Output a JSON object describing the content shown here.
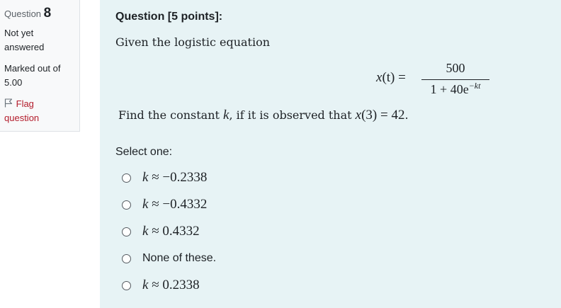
{
  "info": {
    "question_label": "Question",
    "question_number": "8",
    "state_line1": "Not yet",
    "state_line2": "answered",
    "grade_line1": "Marked out of",
    "grade_line2": "5.00",
    "flag_line1": "Flag",
    "flag_line2": "question",
    "flag_icon": "flag-outline-icon"
  },
  "question": {
    "title": "Question [5 points]:",
    "intro": "Given the logistic equation",
    "equation": {
      "lhs_var": "x",
      "lhs_rest": "(t) =",
      "numerator": "500",
      "denominator_base": "1 + 40e",
      "denominator_exponent": "−kt"
    },
    "find_text_before": "Find the constant ",
    "find_var": "k",
    "find_text_mid": ", if it is observed that ",
    "find_condition_var": "x",
    "find_condition_rest": "(3) = 42",
    "find_text_end": ".",
    "prompt": "Select one:"
  },
  "answers": [
    {
      "var": "k",
      "rest": " ≈ −0.2338"
    },
    {
      "var": "k",
      "rest": " ≈ −0.4332"
    },
    {
      "var": "k",
      "rest": " ≈ 0.4332"
    },
    {
      "var": "",
      "rest": "None of these."
    },
    {
      "var": "k",
      "rest": " ≈ 0.2338"
    }
  ],
  "colors": {
    "content_background": "#e7f3f5",
    "info_background": "#f8f9fa",
    "flag_link": "#b31c2b"
  }
}
